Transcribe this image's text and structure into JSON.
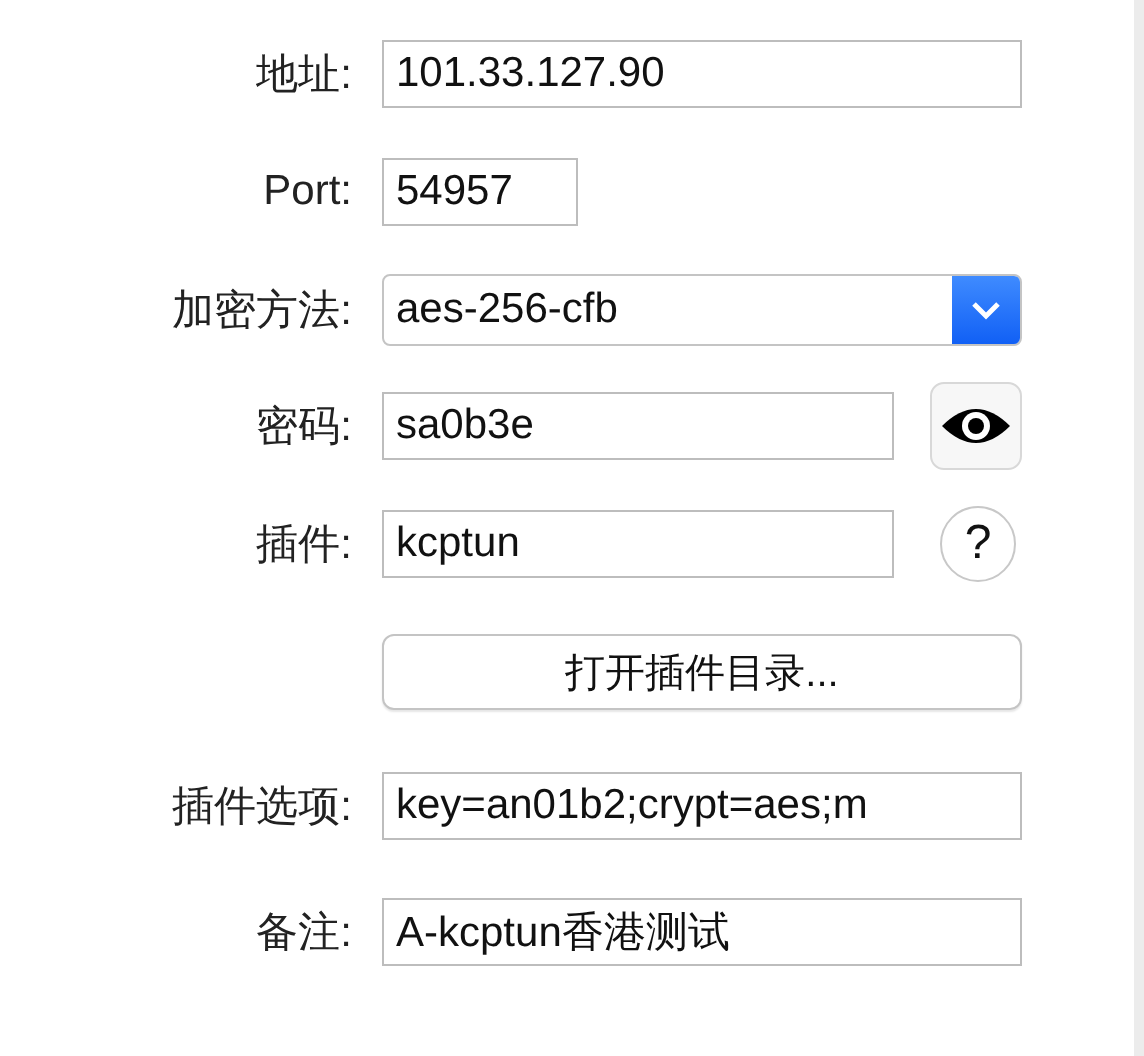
{
  "rows": [
    {
      "kind": "text",
      "label": "地址:",
      "value": "101.33.127.90"
    },
    {
      "kind": "text",
      "label": "Port:",
      "value": "54957"
    },
    {
      "kind": "select",
      "label": "加密方法:",
      "value": "aes-256-cfb"
    },
    {
      "kind": "text",
      "label": "密码:",
      "value": "sa0b3e",
      "accessory": {
        "kind": "reveal"
      }
    },
    {
      "kind": "text",
      "label": "插件:",
      "value": "kcptun",
      "accessory": {
        "kind": "help",
        "text": "?"
      }
    },
    {
      "kind": "button",
      "text": "打开插件目录..."
    },
    {
      "kind": "text",
      "label": "插件选项:",
      "value": "key=an01b2;crypt=aes;m"
    },
    {
      "kind": "text",
      "label": "备注:",
      "value": "A-kcptun香港测试"
    }
  ]
}
